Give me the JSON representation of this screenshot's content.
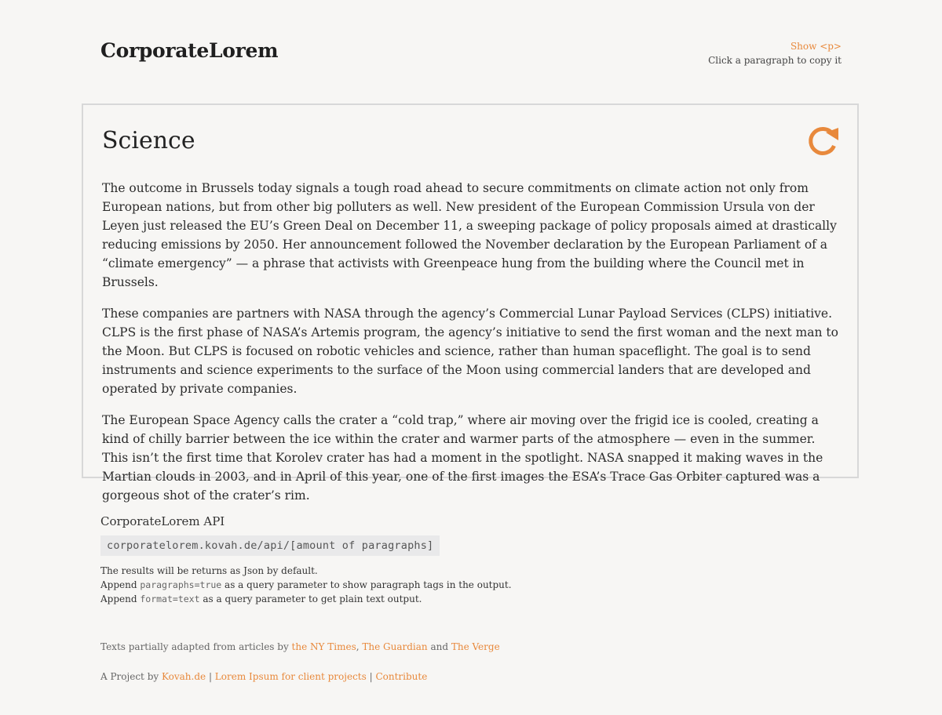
{
  "header": {
    "logo": "CorporateLorem",
    "show_p_label": "Show <p>",
    "copy_hint": "Click a paragraph to copy it"
  },
  "card": {
    "title": "Science",
    "refresh_icon": "refresh-icon",
    "accent_color": "#e8893c",
    "paragraphs": [
      "The outcome in Brussels today signals a tough road ahead to secure commitments on climate action not only from European nations, but from other big polluters as well. New president of the European Commission Ursula von der Leyen just released the EU’s Green Deal on December 11, a sweeping package of policy proposals aimed at drastically reducing emissions by 2050. Her announcement followed the November declaration by the European Parliament of a “climate emergency” — a phrase that activists with Greenpeace hung from the building where the Council met in Brussels.",
      "These companies are partners with NASA through the agency’s Commercial Lunar Payload Services (CLPS) initiative. CLPS is the first phase of NASA’s Artemis program, the agency’s initiative to send the first woman and the next man to the Moon. But CLPS is focused on robotic vehicles and science, rather than human spaceflight. The goal is to send instruments and science experiments to the surface of the Moon using commercial landers that are developed and operated by private companies.",
      "The European Space Agency calls the crater a “cold trap,” where air moving over the frigid ice is cooled, creating a kind of chilly barrier between the ice within the crater and warmer parts of the atmosphere — even in the summer. This isn’t the first time that Korolev crater has had a moment in the spotlight. NASA snapped it making waves in the Martian clouds in 2003, and in April of this year, one of the first images the ESA’s Trace Gas Orbiter captured was a gorgeous shot of the crater’s rim."
    ]
  },
  "api": {
    "title": "CorporateLorem API",
    "url": "corporatelorem.kovah.de/api/[amount of paragraphs]",
    "note_1": "The results will be returns as Json by default.",
    "note_2_prefix": "Append ",
    "note_2_code": "paragraphs=true",
    "note_2_suffix": " as a query parameter to show paragraph tags in the output.",
    "note_3_prefix": "Append ",
    "note_3_code": "format=text",
    "note_3_suffix": " as a query parameter to get plain text output."
  },
  "credits": {
    "prefix": "Texts partially adapted from articles by ",
    "link_1": "the NY Times",
    "sep_1": ", ",
    "link_2": "The Guardian",
    "sep_2": " and ",
    "link_3": "The Verge"
  },
  "footer": {
    "prefix": "A Project by ",
    "link_1": "Kovah.de",
    "sep": " | ",
    "link_2": "Lorem Ipsum for client projects",
    "link_3": "Contribute"
  }
}
